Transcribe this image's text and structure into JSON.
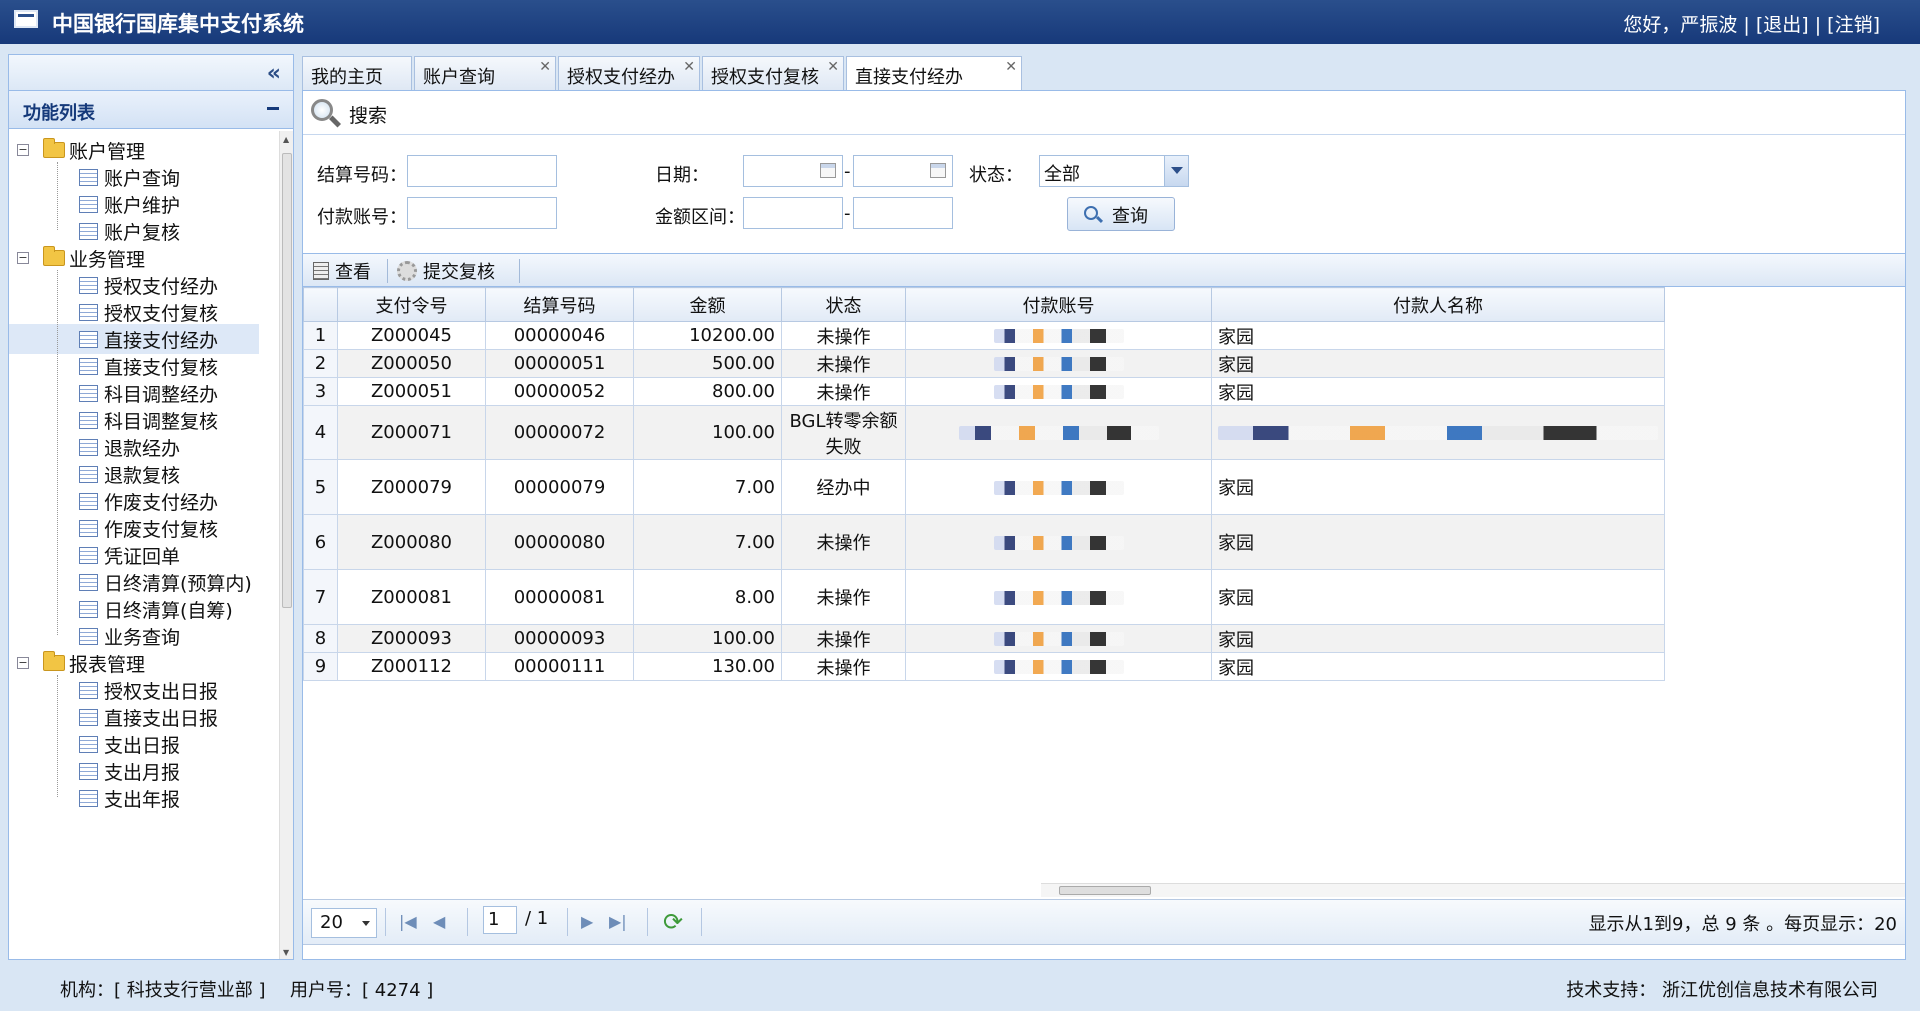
{
  "header": {
    "title": "中国银行国库集中支付系统",
    "greeting": "您好，严振波",
    "logout_label": "[退出]",
    "cancel_label": "[注销]",
    "sep": "|"
  },
  "sidebar": {
    "collapse_icon": "double-chevron-left",
    "panel_title": "功能列表",
    "groups": [
      {
        "label": "账户管理",
        "items": [
          "账户查询",
          "账户维护",
          "账户复核"
        ]
      },
      {
        "label": "业务管理",
        "items": [
          "授权支付经办",
          "授权支付复核",
          "直接支付经办",
          "直接支付复核",
          "科目调整经办",
          "科目调整复核",
          "退款经办",
          "退款复核",
          "作废支付经办",
          "作废支付复核",
          "凭证回单",
          "日终清算(预算内)",
          "日终清算(自筹)",
          "业务查询"
        ]
      },
      {
        "label": "报表管理",
        "items": [
          "授权支出日报",
          "直接支出日报",
          "支出日报",
          "支出月报",
          "支出年报"
        ]
      }
    ],
    "selected_item": "直接支付经办"
  },
  "tabs": [
    {
      "label": "我的主页",
      "closable": false
    },
    {
      "label": "账户查询",
      "closable": true
    },
    {
      "label": "授权支付经办",
      "closable": true
    },
    {
      "label": "授权支付复核",
      "closable": true
    },
    {
      "label": "直接支付经办",
      "closable": true,
      "active": true
    }
  ],
  "search": {
    "title": "搜索",
    "settle_no_label": "结算号码：",
    "settle_no_value": "",
    "date_label": "日期：",
    "date_from": "",
    "date_to": "",
    "range_sep": "-",
    "status_label": "状态：",
    "status_value": "全部",
    "pay_acct_label": "付款账号：",
    "pay_acct_value": "",
    "amount_label": "金额区间：",
    "amount_from": "",
    "amount_to": "",
    "query_label": "查询"
  },
  "toolbar": {
    "view_label": "查看",
    "submit_label": "提交复核"
  },
  "table": {
    "columns": [
      "支付令号",
      "结算号码",
      "金额",
      "状态",
      "付款账号",
      "付款人名称"
    ],
    "rows": [
      {
        "no": "1",
        "order": "Z000045",
        "settle": "00000046",
        "amount": "10200.00",
        "status": "未操作",
        "payer": "家园"
      },
      {
        "no": "2",
        "order": "Z000050",
        "settle": "00000051",
        "amount": "500.00",
        "status": "未操作",
        "payer": "家园"
      },
      {
        "no": "3",
        "order": "Z000051",
        "settle": "00000052",
        "amount": "800.00",
        "status": "未操作",
        "payer": "家园"
      },
      {
        "no": "4",
        "order": "Z000071",
        "settle": "00000072",
        "amount": "100.00",
        "status": "BGL转零余额失败",
        "payer": ""
      },
      {
        "no": "5",
        "order": "Z000079",
        "settle": "00000079",
        "amount": "7.00",
        "status": "经办中",
        "payer": "家园"
      },
      {
        "no": "6",
        "order": "Z000080",
        "settle": "00000080",
        "amount": "7.00",
        "status": "未操作",
        "payer": "家园"
      },
      {
        "no": "7",
        "order": "Z000081",
        "settle": "00000081",
        "amount": "8.00",
        "status": "未操作",
        "payer": "家园"
      },
      {
        "no": "8",
        "order": "Z000093",
        "settle": "00000093",
        "amount": "100.00",
        "status": "未操作",
        "payer": "家园"
      },
      {
        "no": "9",
        "order": "Z000112",
        "settle": "00000111",
        "amount": "130.00",
        "status": "未操作",
        "payer": "家园"
      }
    ]
  },
  "pager": {
    "page_size": "20",
    "page_num": "1",
    "page_total": "/ 1",
    "info": "显示从1到9，总 9 条 。每页显示：20"
  },
  "footer": {
    "org": "机构：[ 科技支行营业部 ]",
    "user": "用户号：[ 4274 ]",
    "support": "技术支持： 浙江优创信息技术有限公司"
  }
}
